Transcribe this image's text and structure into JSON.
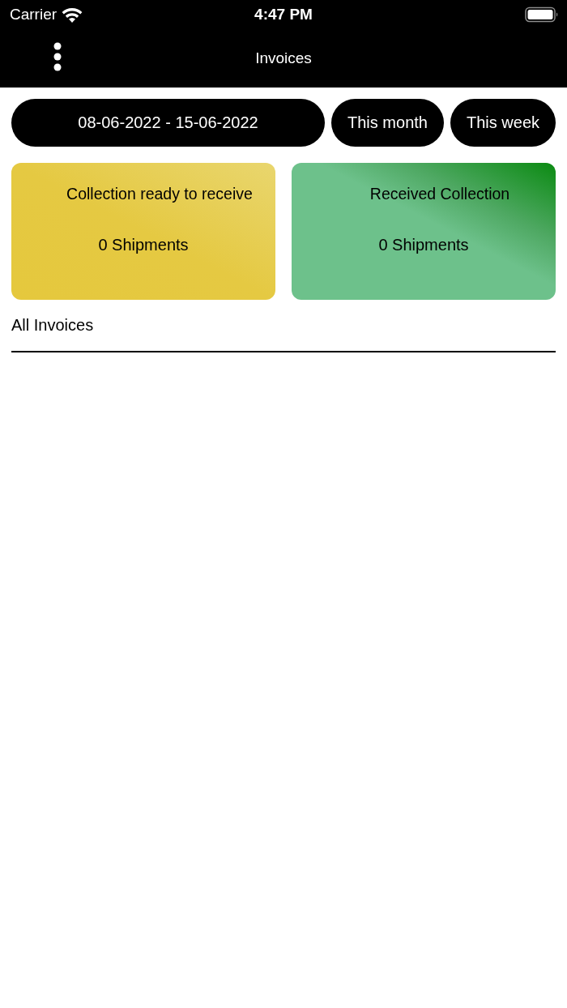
{
  "status_bar": {
    "carrier": "Carrier",
    "time": "4:47 PM"
  },
  "nav_bar": {
    "title": "Invoices"
  },
  "filters": [
    {
      "label": "08-06-2022 - 15-06-2022",
      "kind": "range"
    },
    {
      "label": "This month",
      "kind": "preset"
    },
    {
      "label": "This week",
      "kind": "preset"
    }
  ],
  "summary_cards": [
    {
      "kind": "pending",
      "title": "Collection ready to receive",
      "count": "0 Shipments"
    },
    {
      "kind": "received",
      "title": "Received Collection",
      "count": "0 Shipments"
    }
  ],
  "section": {
    "title": "All Invoices"
  }
}
